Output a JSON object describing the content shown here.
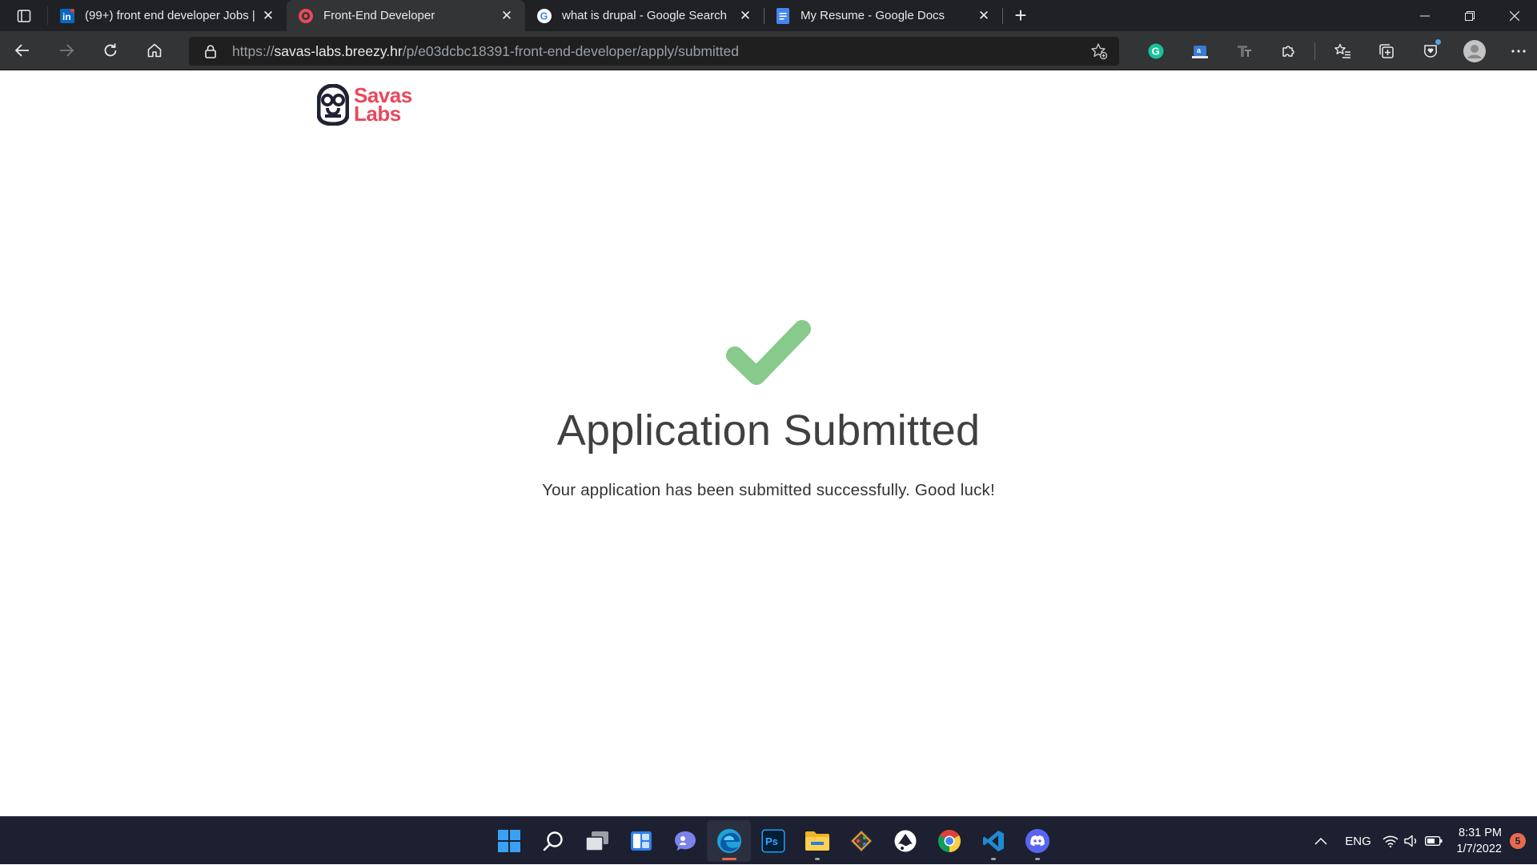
{
  "browser": {
    "tabs": [
      {
        "title": "(99+) front end developer Jobs |",
        "favicon": "linkedin-icon",
        "active": false
      },
      {
        "title": "Front-End Developer",
        "favicon": "breezy-icon",
        "active": true
      },
      {
        "title": "what is drupal - Google Search",
        "favicon": "google-icon",
        "active": false
      },
      {
        "title": "My Resume - Google Docs",
        "favicon": "google-docs-icon",
        "active": false
      }
    ],
    "address": {
      "scheme": "https://",
      "host": "savas-labs.breezy.hr",
      "path": "/p/e03dcbc18391-front-end-developer/apply/submitted"
    }
  },
  "page": {
    "logo_line1": "Savas",
    "logo_line2": "Labs",
    "headline": "Application Submitted",
    "message": "Your application has been submitted successfully. Good luck!",
    "check_color": "#88c98c",
    "brand_color": "#e8485c"
  },
  "taskbar": {
    "apps": [
      "windows-start-icon",
      "search-icon",
      "task-view-icon",
      "widgets-icon",
      "teams-chat-icon",
      "edge-icon",
      "photoshop-icon",
      "file-explorer-icon",
      "git-icon",
      "inkscape-icon",
      "chrome-icon",
      "vscode-icon",
      "discord-icon"
    ],
    "language": "ENG",
    "time": "8:31 PM",
    "date": "1/7/2022",
    "notifications": "5"
  }
}
